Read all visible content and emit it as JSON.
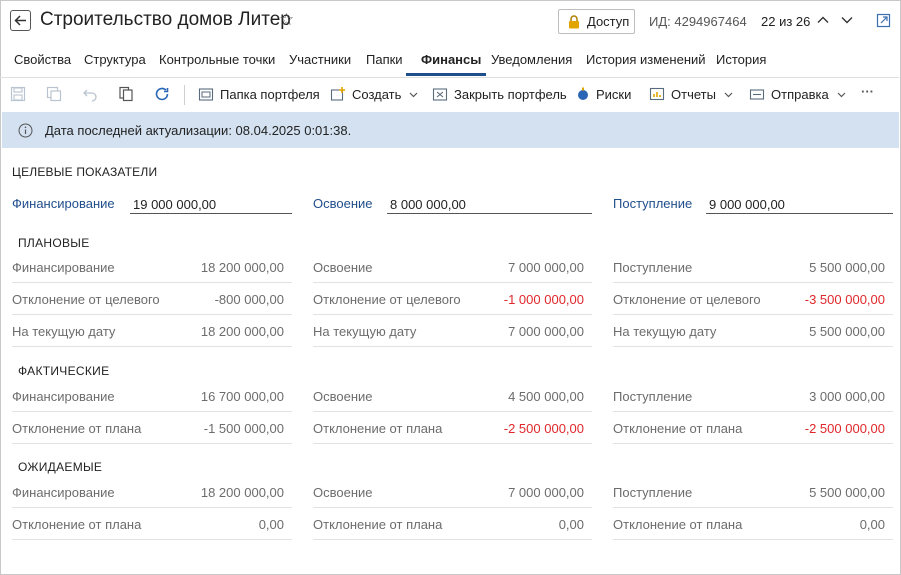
{
  "header": {
    "title": "Строительство домов Литер",
    "access_label": "Доступ",
    "id_text": "ИД: 4294967464",
    "counter": "22 из 26"
  },
  "tabs": [
    {
      "label": "Свойства"
    },
    {
      "label": "Структура"
    },
    {
      "label": "Контрольные точки"
    },
    {
      "label": "Участники"
    },
    {
      "label": "Папки"
    },
    {
      "label": "Финансы",
      "active": true
    },
    {
      "label": "Уведомления"
    },
    {
      "label": "История изменений"
    },
    {
      "label": "История"
    }
  ],
  "toolbar": {
    "portfolio_folder": "Папка портфеля",
    "create": "Создать",
    "close_portfolio": "Закрыть портфель",
    "risks": "Риски",
    "reports": "Отчеты",
    "send": "Отправка",
    "more": "···"
  },
  "banner": {
    "text": "Дата последней актуализации: 08.04.2025 0:01:38."
  },
  "targets": {
    "caption": "ЦЕЛЕВЫЕ ПОКАЗАТЕЛИ",
    "financing_label": "Финансирование",
    "financing_value": "19 000 000,00",
    "development_label": "Освоение",
    "development_value": "8 000 000,00",
    "income_label": "Поступление",
    "income_value": "9 000 000,00"
  },
  "planned": {
    "title": "ПЛАНОВЫЕ",
    "col1": [
      {
        "label": "Финансирование",
        "value": "18 200 000,00"
      },
      {
        "label": "Отклонение от целевого",
        "value": "-800 000,00"
      },
      {
        "label": "На текущую дату",
        "value": "18 200 000,00"
      }
    ],
    "col2": [
      {
        "label": "Освоение",
        "value": "7 000 000,00"
      },
      {
        "label": "Отклонение от целевого",
        "value": "-1 000 000,00"
      },
      {
        "label": "На текущую дату",
        "value": "7 000 000,00"
      }
    ],
    "col3": [
      {
        "label": "Поступление",
        "value": "5 500 000,00"
      },
      {
        "label": "Отклонение от целевого",
        "value": "-3 500 000,00"
      },
      {
        "label": "На текущую дату",
        "value": "5 500 000,00"
      }
    ]
  },
  "actual": {
    "title": "ФАКТИЧЕСКИЕ",
    "col1": [
      {
        "label": "Финансирование",
        "value": "16 700 000,00"
      },
      {
        "label": "Отклонение от плана",
        "value": "-1 500 000,00"
      }
    ],
    "col2": [
      {
        "label": "Освоение",
        "value": "4 500 000,00"
      },
      {
        "label": "Отклонение от плана",
        "value": "-2 500 000,00"
      }
    ],
    "col3": [
      {
        "label": "Поступление",
        "value": "3 000 000,00"
      },
      {
        "label": "Отклонение от плана",
        "value": "-2 500 000,00"
      }
    ]
  },
  "expected": {
    "title": "ОЖИДАЕМЫЕ",
    "col1": [
      {
        "label": "Финансирование",
        "value": "18 200 000,00"
      },
      {
        "label": "Отклонение от плана",
        "value": "0,00"
      }
    ],
    "col2": [
      {
        "label": "Освоение",
        "value": "7 000 000,00"
      },
      {
        "label": "Отклонение от плана",
        "value": "0,00"
      }
    ],
    "col3": [
      {
        "label": "Поступление",
        "value": "5 500 000,00"
      },
      {
        "label": "Отклонение от плана",
        "value": "0,00"
      }
    ]
  },
  "colors": {
    "accent": "#1f4e8c",
    "negative": "#e0282c",
    "banner_bg": "#d3e1f1",
    "muted_text": "#6c6c6c"
  },
  "icons": {
    "back": "back-arrow-icon",
    "star": "star-icon",
    "lock": "lock-icon",
    "info": "info-icon"
  }
}
